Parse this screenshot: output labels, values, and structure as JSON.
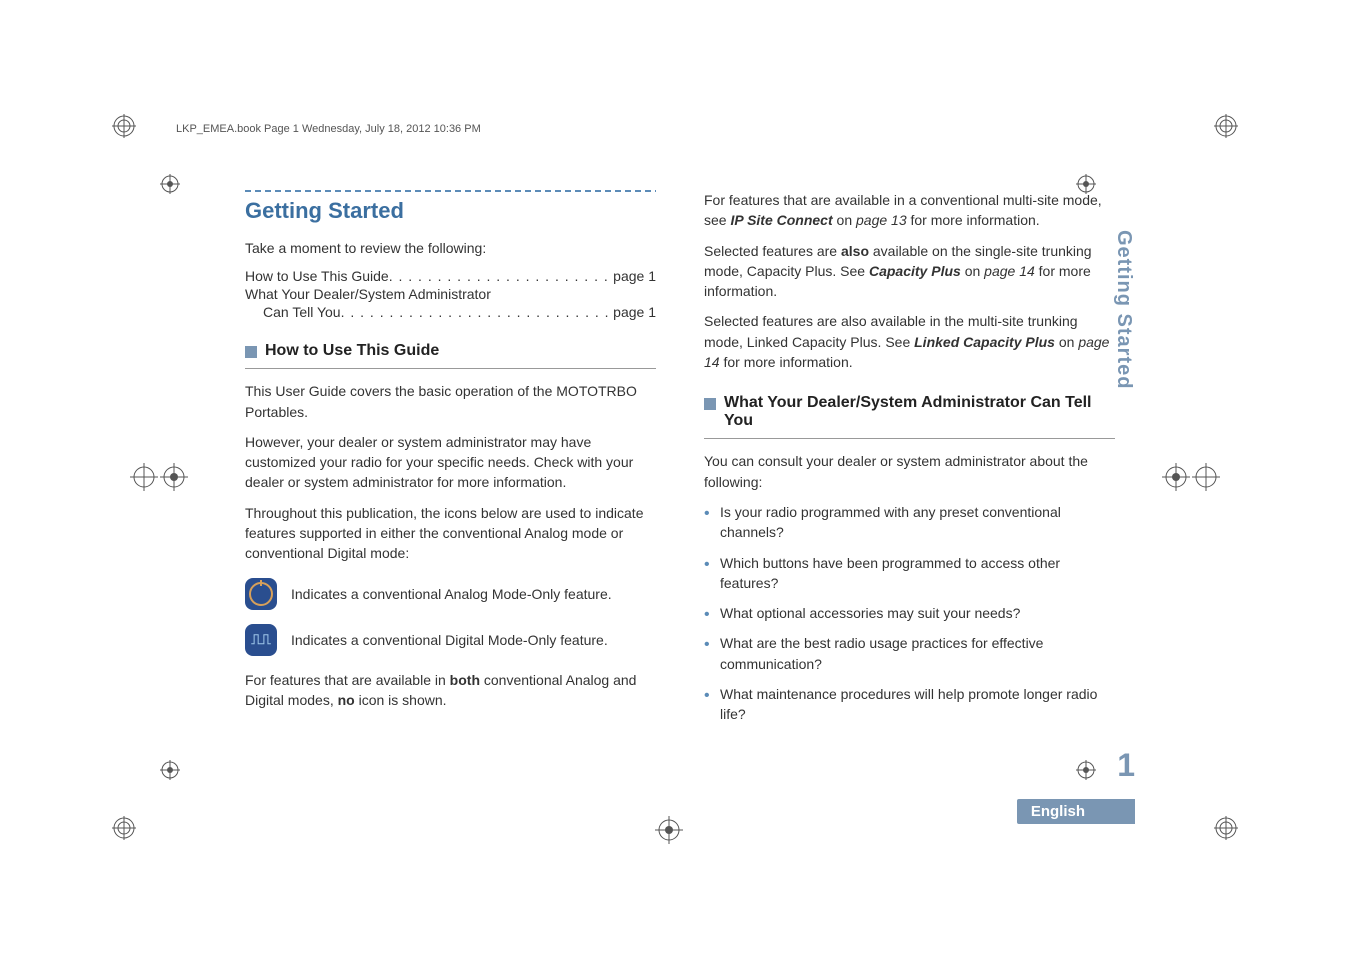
{
  "header_line": "LKP_EMEA.book  Page 1  Wednesday, July 18, 2012  10:36 PM",
  "section_title": "Getting Started",
  "intro": "Take a moment to review the following:",
  "toc": {
    "item1_label": "How to Use This Guide",
    "item1_page": "page 1",
    "item2_line1": "What Your Dealer/System Administrator",
    "item2_line2_label": "Can Tell You",
    "item2_page": "page 1"
  },
  "sub1": {
    "title": "How to Use This Guide",
    "p1": "This User Guide covers the basic operation of the MOTOTRBO Portables.",
    "p2": "However, your dealer or system administrator may have customized your radio for your specific needs. Check with your dealer or system administrator for more information.",
    "p3": "Throughout this publication, the icons below are used to indicate features supported in either the conventional Analog mode or conventional Digital mode:",
    "analog_caption": "Indicates a conventional Analog Mode-Only feature.",
    "digital_caption": "Indicates a conventional Digital Mode-Only feature.",
    "p4_a": "For features that are available in ",
    "p4_bold": "both",
    "p4_b": " conventional Analog and Digital modes, ",
    "p4_bold2": "no",
    "p4_c": " icon is shown."
  },
  "col2": {
    "p1_a": "For features that are available in a conventional multi-site mode, see ",
    "p1_link": "IP Site Connect",
    "p1_b": " on ",
    "p1_page": "page 13",
    "p1_c": " for more information.",
    "p2_a": "Selected features are ",
    "p2_bold": "also",
    "p2_b": " available on the single-site trunking mode, Capacity Plus. See ",
    "p2_link": "Capacity Plus",
    "p2_c": " on ",
    "p2_page": "page 14",
    "p2_d": " for more information.",
    "p3_a": "Selected features are also available in the multi-site trunking mode, Linked Capacity Plus. See ",
    "p3_link": "Linked Capacity Plus",
    "p3_b": " on ",
    "p3_page": "page 14",
    "p3_c": " for more information."
  },
  "sub2": {
    "title": "What Your Dealer/System Administrator Can Tell You",
    "intro": "You can consult your dealer or system administrator about the following:",
    "bullets": [
      "Is your radio programmed with any preset conventional channels?",
      "Which buttons have been programmed to access other features?",
      "What optional accessories may suit your needs?",
      "What are the best radio usage practices for effective communication?",
      "What maintenance procedures will help promote longer radio life?"
    ]
  },
  "side_tab": "Getting Started",
  "page_number": "1",
  "language": "English"
}
